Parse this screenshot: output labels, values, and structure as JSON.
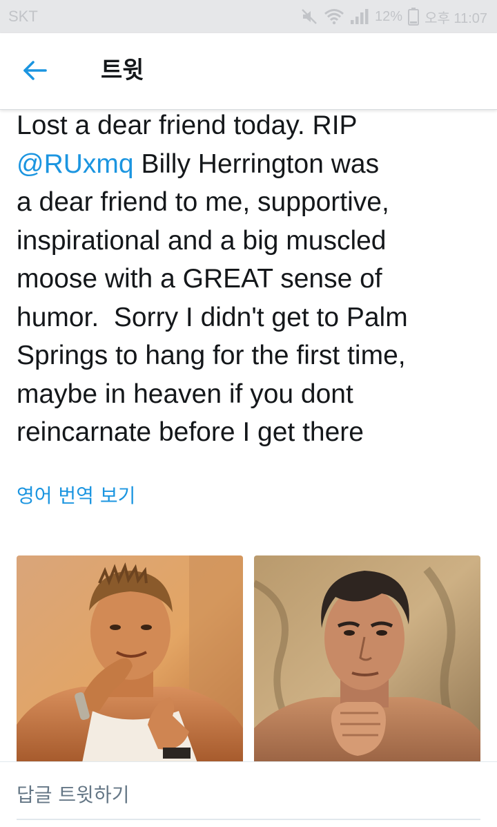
{
  "status_bar": {
    "carrier": "SKT",
    "battery": "12%",
    "time": "오후 11:07",
    "icons": [
      "mute-icon",
      "wifi-icon",
      "signal-icon",
      "battery-icon"
    ]
  },
  "app_bar": {
    "back_icon": "arrow-left-icon",
    "title": "트윗"
  },
  "tweet": {
    "lines": [
      "Lost a dear friend today. RIP",
      "Billy Herrington was",
      "a dear friend to me, supportive,",
      "inspirational and a big muscled",
      "moose with a GREAT sense of",
      "humor.  Sorry I didn't get to Palm",
      "Springs to hang for the first time,",
      "maybe in heaven if you dont",
      "reincarnate before I get there"
    ],
    "mention": "@RUxmq",
    "translate_label": "영어 번역 보기",
    "photos": [
      "photo-1",
      "photo-2"
    ]
  },
  "reply": {
    "placeholder": "답글 트윗하기"
  },
  "colors": {
    "accent": "#1b95e0",
    "text": "#14171a",
    "secondary": "#657786",
    "status_bar_bg": "#e6e7e9"
  }
}
